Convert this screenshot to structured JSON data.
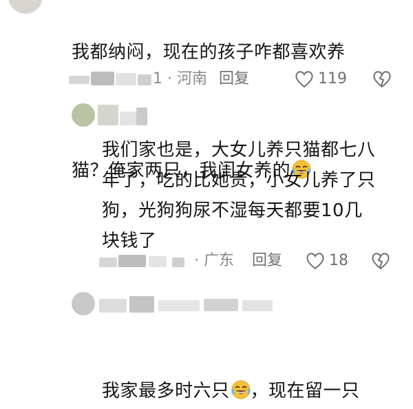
{
  "comments": [
    {
      "text_line1": "我都纳闷，现在的孩子咋都喜欢养",
      "text_line2": "猫？俺家两只，我闺女养的",
      "emoji": "laughing-tears-emoji",
      "meta_suffix": "1",
      "location": "· 河南",
      "reply_label": "回复",
      "likes": "119"
    },
    {
      "text": "我们家也是，大女儿养只猫都七八\n年了，吃的比她贵，小女儿养了只\n狗，光狗狗尿不湿每天都要10几\n块钱了",
      "location": "· 广东",
      "reply_label": "回复",
      "likes": "18"
    },
    {
      "text_before": "我家最多时六只",
      "emoji": "laughing-tears-emoji",
      "text_after": "，现在留一只"
    }
  ],
  "colors": {
    "text": "#161616",
    "meta": "#8a8a8a",
    "emoji_face": "#f5c33b"
  },
  "icons": [
    "heart-outline-icon",
    "dislike-heart-icon",
    "laughing-tears-emoji"
  ]
}
